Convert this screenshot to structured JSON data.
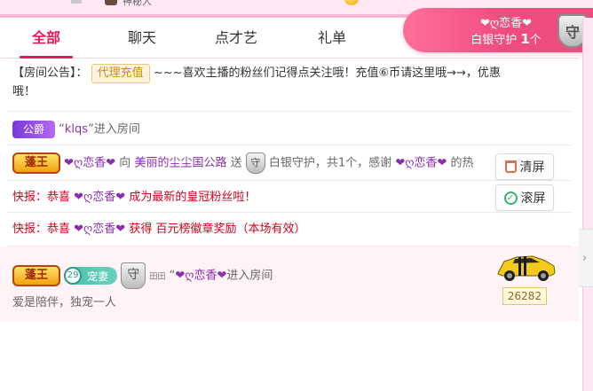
{
  "top_strip": {
    "username": "神秘人"
  },
  "tabs": [
    {
      "label": "全部",
      "active": true
    },
    {
      "label": "聊天",
      "active": false
    },
    {
      "label": "点才艺",
      "active": false
    },
    {
      "label": "礼单",
      "active": false
    }
  ],
  "guard_badge": {
    "nickname": "❤ღ恋香❤",
    "desc_prefix": "白银守护",
    "count": "1",
    "count_unit": "个",
    "shield_char": "守"
  },
  "announcement": {
    "label": "【房间公告】：",
    "tag": "代理充值",
    "text_line1": "~~~喜欢主播的粉丝们记得点关注哦！充值⑥币请这里哦→→，优惠",
    "text_line2": "哦！"
  },
  "enter_row_1": {
    "badge": "公爵",
    "open_quote": "“",
    "name": "klqs",
    "close_quote": "”",
    "suffix": "进入房间"
  },
  "gift_row": {
    "badge": "蓬王",
    "sender": "❤ღ恋香❤",
    "verb_to": "向",
    "receiver": "美丽的尘尘国公路",
    "verb_send": "送",
    "shield_char": "守",
    "gift_desc": "白银守护，共1个，感谢",
    "thanks_name": "❤ღ恋香❤",
    "tail": "的热"
  },
  "flash_1": {
    "prefix": "快报：恭喜",
    "name": "❤ღ恋香❤",
    "text": "成为最新的皇冠粉丝啦！"
  },
  "flash_2": {
    "prefix": "快报：恭喜",
    "name": "❤ღ恋香❤",
    "text": "获得 百元榜徽章奖励（本场有效）"
  },
  "side_buttons": {
    "clear": "清屏",
    "scroll": "滚屏"
  },
  "entrance": {
    "badge": "蓬王",
    "level": "29",
    "pet_label": "宠妻",
    "shield_char": "守",
    "shield_sub": "田田",
    "open_quote": "“",
    "name": "❤ღ恋香❤",
    "suffix": "进入房间",
    "slogan": "爱是陪伴，独宠一人",
    "score": "26282"
  },
  "colors": {
    "accent": "#e8195a",
    "purple": "#8b2fae",
    "flash_red": "#d0021b",
    "guard_pink": "#ef4c7e"
  }
}
